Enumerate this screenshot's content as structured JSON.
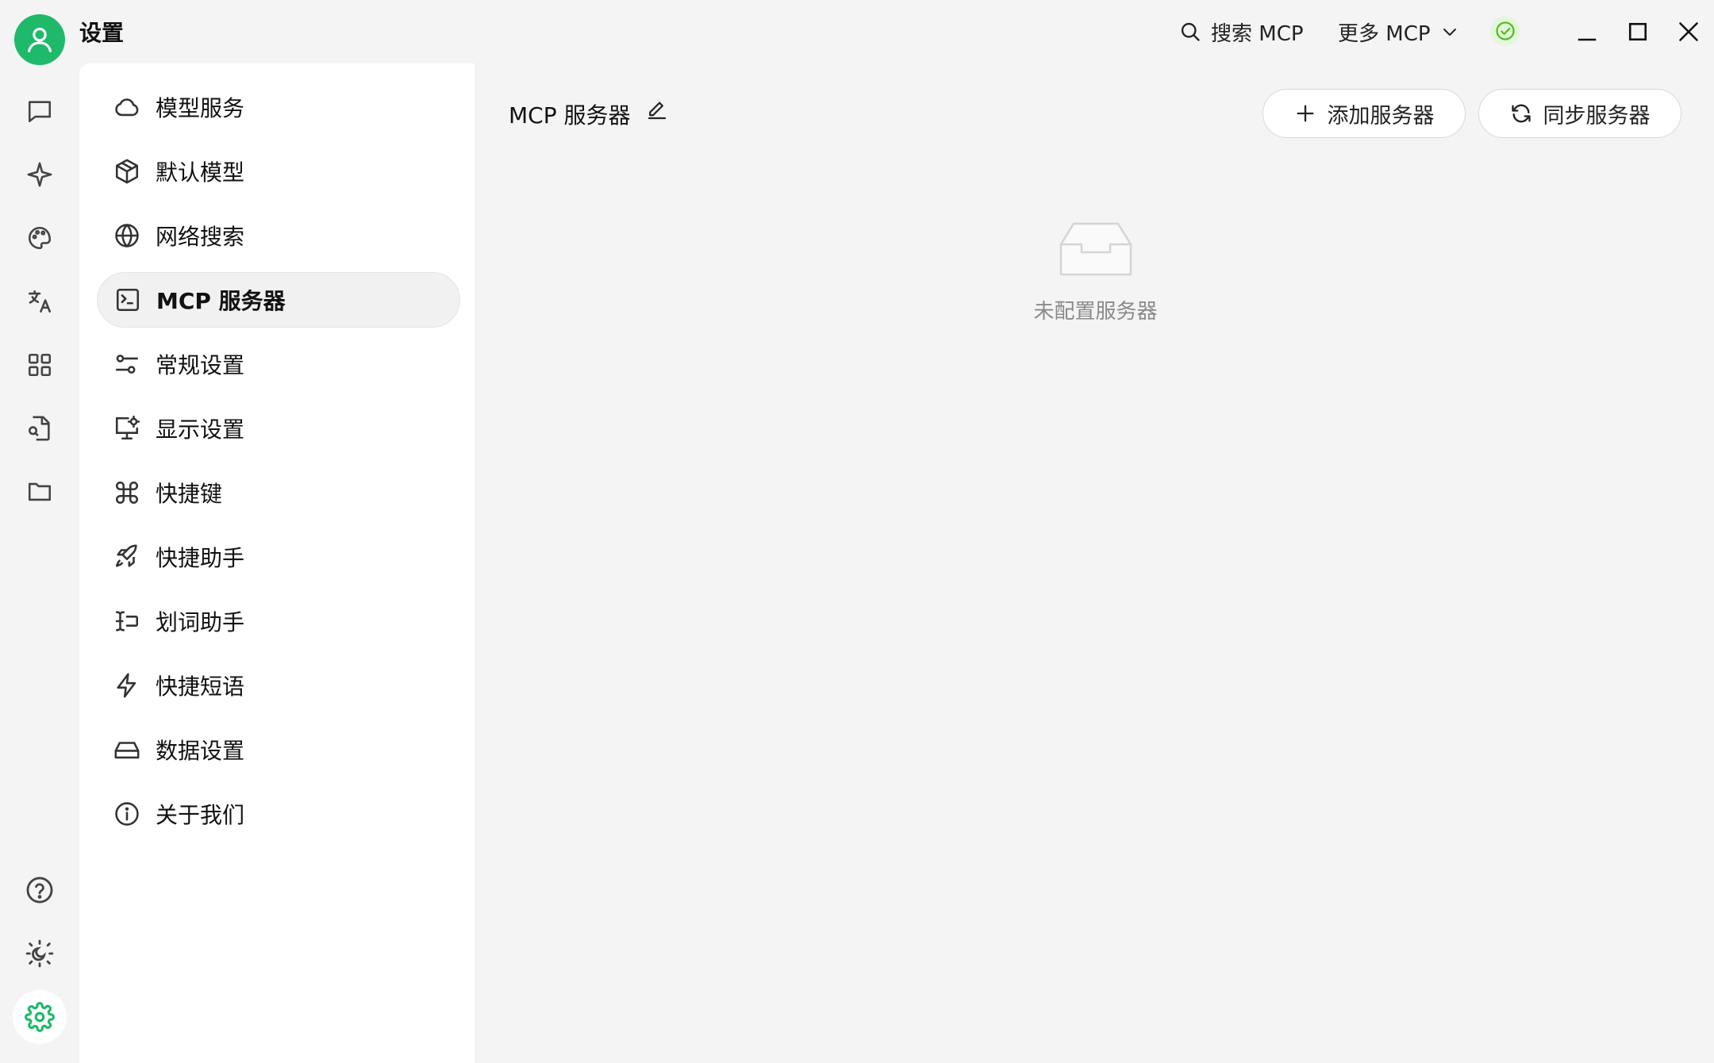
{
  "app": {
    "title": "设置"
  },
  "topbar": {
    "search_label": "搜索 MCP",
    "more_label": "更多 MCP"
  },
  "menu": {
    "items": [
      {
        "label": "模型服务",
        "icon": "cloud-icon"
      },
      {
        "label": "默认模型",
        "icon": "cube-icon"
      },
      {
        "label": "网络搜索",
        "icon": "globe-icon"
      },
      {
        "label": "MCP 服务器",
        "icon": "terminal-icon",
        "active": true
      },
      {
        "label": "常规设置",
        "icon": "sliders-icon"
      },
      {
        "label": "显示设置",
        "icon": "monitor-settings-icon"
      },
      {
        "label": "快捷键",
        "icon": "command-icon"
      },
      {
        "label": "快捷助手",
        "icon": "rocket-icon"
      },
      {
        "label": "划词助手",
        "icon": "text-cursor-icon"
      },
      {
        "label": "快捷短语",
        "icon": "zap-icon"
      },
      {
        "label": "数据设置",
        "icon": "hard-drive-icon"
      },
      {
        "label": "关于我们",
        "icon": "info-icon"
      }
    ]
  },
  "main": {
    "title": "MCP 服务器",
    "add_button": "添加服务器",
    "sync_button": "同步服务器",
    "empty_text": "未配置服务器"
  },
  "colors": {
    "brand": "#1fb96a",
    "status_ok": "#52c41a",
    "background": "#f4f4f4"
  }
}
